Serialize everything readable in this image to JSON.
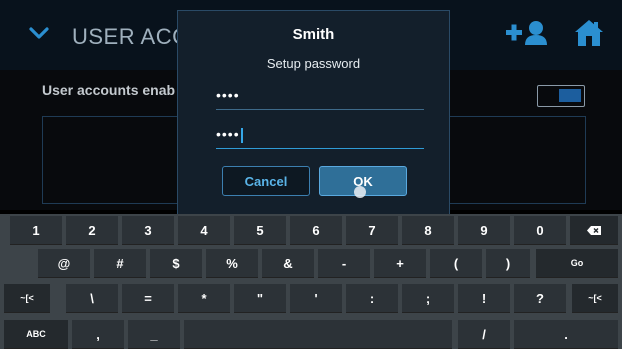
{
  "app": {
    "title": "USER ACCO",
    "accounts_label": "User accounts enab",
    "toggle_on": true
  },
  "dialog": {
    "title": "Smith",
    "subtitle": "Setup password",
    "password_mask": "••••",
    "confirm_mask": "••••",
    "cancel_label": "Cancel",
    "ok_label": "OK"
  },
  "keyboard": {
    "row1": [
      "1",
      "2",
      "3",
      "4",
      "5",
      "6",
      "7",
      "8",
      "9",
      "0"
    ],
    "row2": [
      "@",
      "#",
      "$",
      "%",
      "&",
      "-",
      "+",
      "(",
      ")"
    ],
    "go_label": "Go",
    "row3": [
      "~[<",
      "\\",
      "=",
      "*",
      "\"",
      "'",
      ":",
      ";",
      "!",
      "?",
      "~[<"
    ],
    "abc_label": "ABC",
    "row4_left": [
      ",",
      "_"
    ],
    "row4_right": [
      "/",
      "."
    ]
  },
  "colors": {
    "accent": "#2f9bd6",
    "dialog_bg": "#131f2b",
    "key_bg": "#2c3237",
    "keyboard_bg": "#3d4449"
  },
  "icons": [
    "chevron-down-icon",
    "add-user-icon",
    "home-icon",
    "backspace-icon"
  ]
}
